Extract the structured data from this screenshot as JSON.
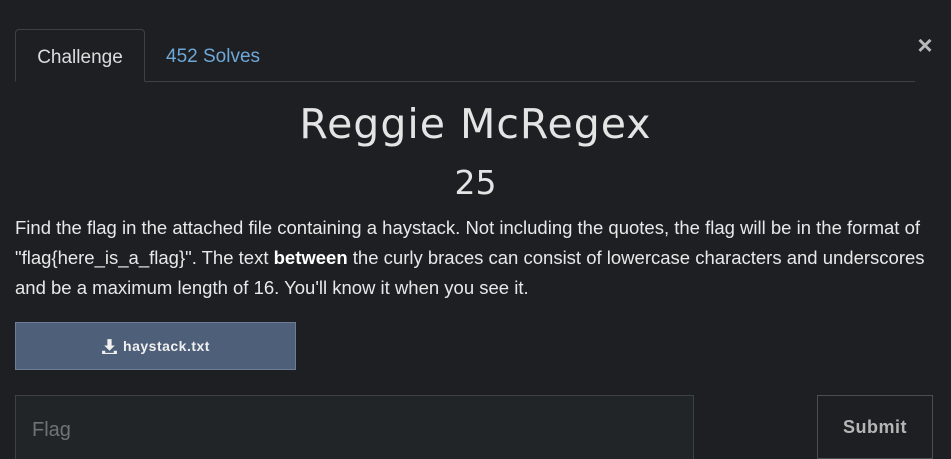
{
  "tabs": {
    "challenge": "Challenge",
    "solves": "452 Solves"
  },
  "close": "×",
  "challenge": {
    "name": "Reggie McRegex",
    "value": "25",
    "description": {
      "part1": "Find the flag in the attached file containing a haystack. Not including the quotes, the flag will be in the format of \"flag{here_is_a_flag}\". The text ",
      "bold": "between",
      "part2": " the curly braces can consist of lowercase characters and underscores and be a maximum length of 16. You'll know it when you see it."
    }
  },
  "file": {
    "name": "haystack.txt",
    "icon": "download-icon"
  },
  "form": {
    "placeholder": "Flag",
    "value": "",
    "submit_label": "Submit"
  }
}
